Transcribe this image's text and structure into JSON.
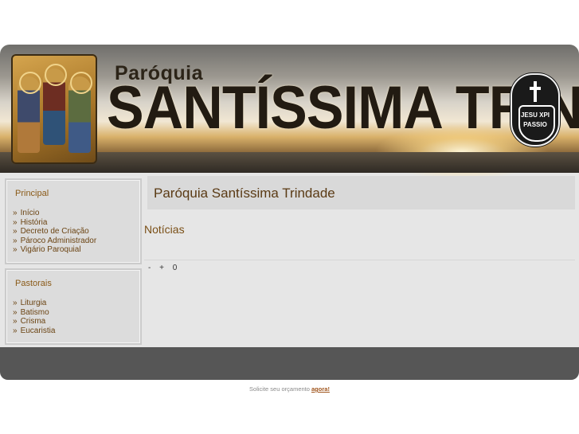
{
  "header": {
    "title_small": "Paróquia",
    "title_big": "SANTÍSSIMA TRINDADE",
    "emblem_line1": "JESU XPI",
    "emblem_line2": "PASSIO"
  },
  "sidebar": {
    "boxes": [
      {
        "title": "Principal",
        "items": [
          {
            "label": "Início"
          },
          {
            "label": "História"
          },
          {
            "label": "Decreto de Criação"
          },
          {
            "label": "Pároco Administrador"
          },
          {
            "label": "Vigário Paroquial"
          }
        ]
      },
      {
        "title": "Pastorais",
        "items": [
          {
            "label": "Liturgia"
          },
          {
            "label": "Batismo"
          },
          {
            "label": "Crisma"
          },
          {
            "label": "Eucaristia"
          }
        ]
      }
    ],
    "bullet": "»"
  },
  "main": {
    "title": "Paróquia Santíssima Trindade",
    "section_title": "Notícias",
    "pager": {
      "minus": "-",
      "plus": "+",
      "count": "0"
    }
  },
  "credit": {
    "text": "Solicite seu orçamento",
    "link": "agora!"
  },
  "colors": {
    "link_brown": "#6b4413",
    "heading_brown": "#8a5a18",
    "footer_bar": "#565656"
  }
}
